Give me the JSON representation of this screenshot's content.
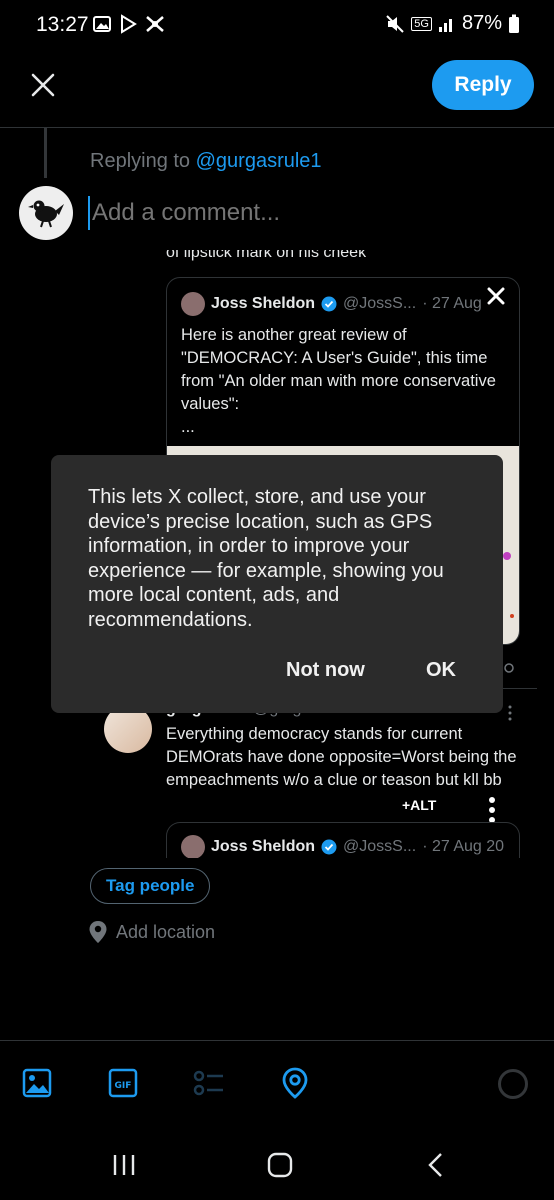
{
  "status_bar": {
    "time": "13:27",
    "battery": "87%",
    "network": "5G"
  },
  "top_bar": {
    "reply_label": "Reply"
  },
  "replying": {
    "prefix": "Replying to ",
    "handle": "@gurgasrule1"
  },
  "composer": {
    "placeholder": "Add a comment..."
  },
  "context": {
    "cut_text": "of lipstick mark on his cheek"
  },
  "quoted_tweet": {
    "name": "Joss Sheldon",
    "handle": "@JossS...",
    "date": "· 27 Aug",
    "body": "Here is another great review of \"DEMOCRACY: A User's Guide\", this time from \"An older man with more conservative values\":\n..."
  },
  "dialog": {
    "text": "This lets X collect, store, and use your device’s precise location, such as GPS information, in order to improve your experience — for example, showing you more local content, ads, and recommendations.",
    "not_now": "Not now",
    "ok": "OK"
  },
  "reply_tweet": {
    "name": "gurgasrule",
    "handle": "@gurgasrule1 · 18 Jun",
    "body": "Everything democracy stands for current DEMOrats have done opposite=Worst being the empeachments w/o a clue or teason but kll bb",
    "alt_badge": "+ALT"
  },
  "quoted_tweet_2": {
    "name": "Joss Sheldon",
    "handle": "@JossS...",
    "date": "· 27 Aug 20"
  },
  "actions": {
    "tag_people": "Tag people",
    "add_location": "Add location"
  },
  "colors": {
    "accent": "#1d9bf0",
    "background": "#000000",
    "dialog_bg": "#2b2b2b",
    "muted": "#71767b"
  },
  "icons": {
    "close": "close-icon",
    "image": "image-icon",
    "gif": "gif-icon",
    "poll": "poll-icon",
    "location": "location-pin-icon"
  }
}
